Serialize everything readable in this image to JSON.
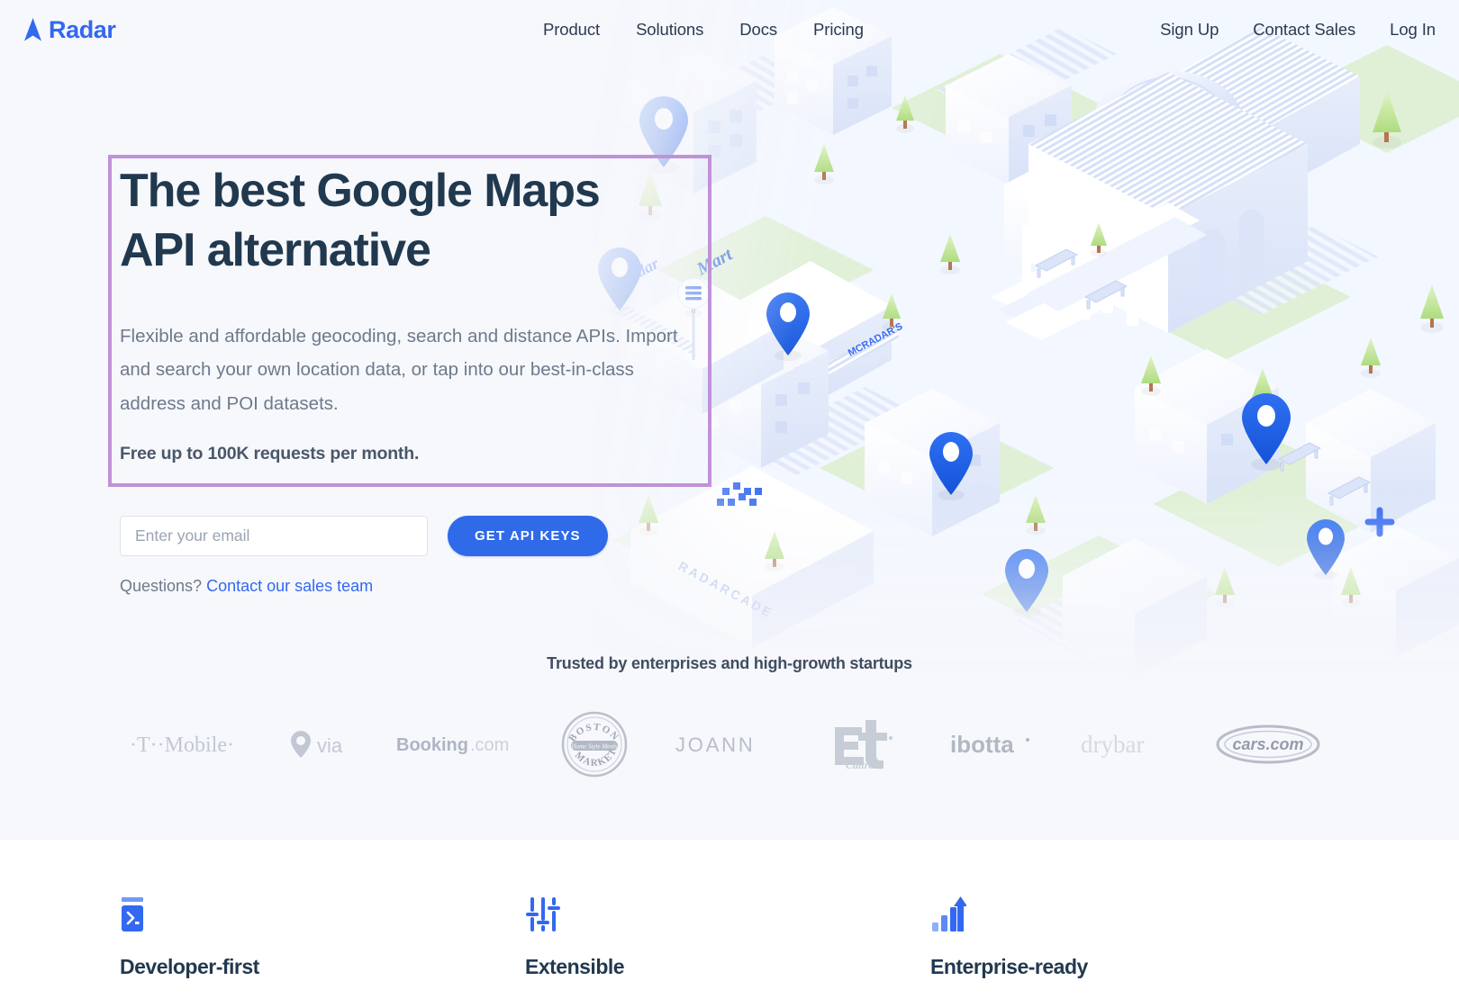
{
  "brand": {
    "name": "Radar",
    "logo_icon": "radar-arrow-icon",
    "accent": "#3368f0",
    "cta_blue": "#2f6ae8",
    "headline_color": "#21394f",
    "page_bg": "#f7f8fc",
    "highlight_border": "#c092d8"
  },
  "nav": {
    "center_links": [
      {
        "label": "Product",
        "name": "nav-product"
      },
      {
        "label": "Solutions",
        "name": "nav-solutions"
      },
      {
        "label": "Docs",
        "name": "nav-docs"
      },
      {
        "label": "Pricing",
        "name": "nav-pricing"
      }
    ],
    "right_links": [
      {
        "label": "Sign Up",
        "name": "nav-sign-up"
      },
      {
        "label": "Contact Sales",
        "name": "nav-contact-sales"
      },
      {
        "label": "Log In",
        "name": "nav-log-in"
      }
    ]
  },
  "hero": {
    "headline_line1": "The best Google Maps",
    "headline_line2": "API alternative",
    "subcopy": "Flexible and affordable geocoding, search and distance APIs. Import and search your own location data, or tap into our best-in-class address and POI datasets.",
    "free_note": "Free up to 100K requests per month.",
    "email_placeholder": "Enter your email",
    "email_value": "",
    "cta_label": "GET API KEYS",
    "questions_prefix": "Questions?",
    "questions_link": "Contact our sales team"
  },
  "illustration": {
    "type": "isometric-city-map",
    "signs": [
      "Radar",
      "Mart",
      "RADARCADE",
      "MCRADAR'S",
      "MCRADAR'S"
    ],
    "pin_color": "#1f63e8",
    "pin_count": 8,
    "tree_color": "#c6e49a",
    "grass_color": "#dcefd0",
    "building_color": "#e5ebfa"
  },
  "trusted": {
    "heading": "Trusted by enterprises and high-growth startups",
    "logos": [
      {
        "name": "logo-t-mobile",
        "label": "T-Mobile"
      },
      {
        "name": "logo-via",
        "label": "via"
      },
      {
        "name": "logo-booking-com",
        "label": "Booking.com"
      },
      {
        "name": "logo-boston-market",
        "label": "Boston Market Home Style Meals"
      },
      {
        "name": "logo-joann",
        "label": "JOANN"
      },
      {
        "name": "logo-caltrans",
        "label": "Caltrans"
      },
      {
        "name": "logo-ibotta",
        "label": "ibotta"
      },
      {
        "name": "logo-drybar",
        "label": "drybar"
      },
      {
        "name": "logo-cars-com",
        "label": "cars.com"
      }
    ]
  },
  "features": [
    {
      "name": "feature-developer-first",
      "icon": "terminal-icon",
      "title": "Developer-first"
    },
    {
      "name": "feature-extensible",
      "icon": "sliders-icon",
      "title": "Extensible"
    },
    {
      "name": "feature-enterprise-ready",
      "icon": "bar-chart-arrow-icon",
      "title": "Enterprise-ready"
    }
  ]
}
